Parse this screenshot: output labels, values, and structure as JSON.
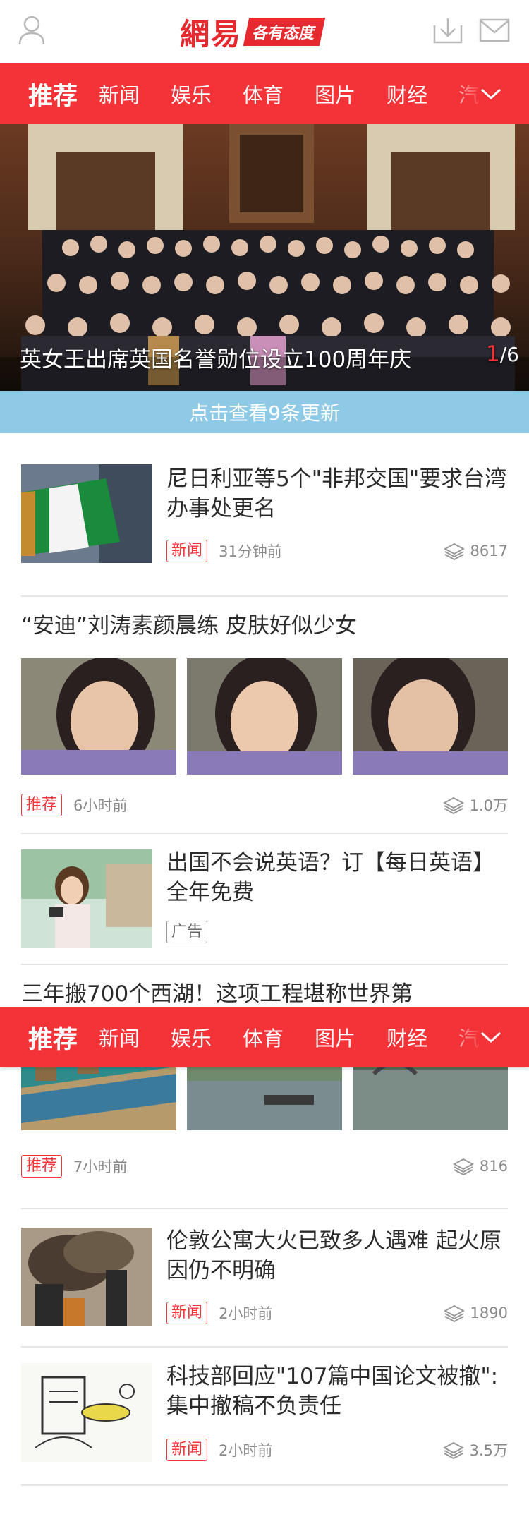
{
  "brand": {
    "logo_text": "網易",
    "slogan": "各有态度",
    "colors": {
      "primary": "#f43338",
      "update_bar": "#8ecae6"
    }
  },
  "header": {
    "user_icon": "user-icon",
    "download_icon": "download-icon",
    "mail_icon": "mail-icon"
  },
  "channels": {
    "active": "推荐",
    "items": [
      "新闻",
      "娱乐",
      "体育",
      "图片",
      "财经",
      "汽"
    ],
    "more_icon": "chevron-down-icon"
  },
  "hero": {
    "caption": "英女王出席英国名誉勋位设立100周年庆",
    "page_current": "1",
    "page_total": "/6"
  },
  "update_notice": "点击查看9条更新",
  "feed": [
    {
      "title": "尼日利亚等5个\"非邦交国\"要求台湾办事处更名",
      "tag": "新闻",
      "time": "31分钟前",
      "count": "8617"
    },
    {
      "title": "“安迪”刘涛素颜晨练 皮肤好似少女",
      "tag": "推荐",
      "time": "6小时前",
      "count": "1.0万"
    },
    {
      "title": "出国不会说英语？订【每日英语】全年免费",
      "tag": "广告"
    },
    {
      "title": "三年搬700个西湖！这项工程堪称世界第",
      "tag": "推荐",
      "time": "7小时前",
      "count": "816"
    },
    {
      "title": "伦敦公寓大火已致多人遇难 起火原因仍不明确",
      "tag": "新闻",
      "time": "2小时前",
      "count": "1890"
    },
    {
      "title": "科技部回应\"107篇中国论文被撤\":集中撤稿不负责任",
      "tag": "新闻",
      "time": "2小时前",
      "count": "3.5万"
    }
  ]
}
